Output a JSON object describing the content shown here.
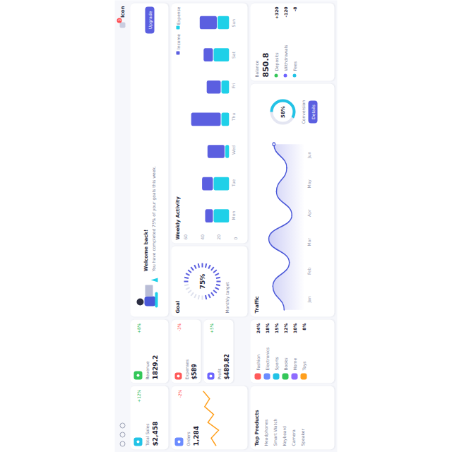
{
  "topbar": {
    "user": "Icon",
    "notifications": "3"
  },
  "stats": [
    {
      "label": "Total Sales",
      "value": "$2,458",
      "change": "+12%",
      "up": true,
      "color": "#22c3e6"
    },
    {
      "label": "Revenue",
      "value": "1829.2",
      "change": "+8%",
      "up": true,
      "color": "#34c759"
    }
  ],
  "banner": {
    "title": "Welcome back!",
    "text": "You have completed 75% of your goals this week.",
    "button": "Upgrade"
  },
  "orders": {
    "label": "Orders",
    "value": "1,284",
    "change": "-2%",
    "up": false,
    "series": [
      12,
      18,
      9,
      22,
      15,
      26,
      20,
      28
    ]
  },
  "mini_stats": [
    {
      "label": "Expenses",
      "value": "$589",
      "change": "-3%",
      "up": false,
      "color": "#ff5a5a"
    },
    {
      "label": "Profit",
      "value": "$489.82",
      "change": "+5%",
      "up": true,
      "color": "#6c63ff"
    }
  ],
  "gauge": {
    "label": "Goal",
    "reading": "75%",
    "level": 0.75,
    "caption": "Monthly target"
  },
  "bar_chart": {
    "title": "Weekly Activity",
    "legend": [
      {
        "label": "Income",
        "color": "#5b5fe0"
      },
      {
        "label": "Expense",
        "color": "#1fd0e8"
      }
    ],
    "labels": [
      "Mon",
      "Tue",
      "Wed",
      "Thu",
      "Fri",
      "Sat",
      "Sun"
    ],
    "ticks": [
      "60",
      "40",
      "20",
      "0"
    ],
    "series": [
      [
        10,
        14,
        22,
        38,
        18,
        12,
        22
      ],
      [
        20,
        20,
        5,
        10,
        10,
        20,
        15
      ]
    ]
  },
  "list": {
    "title": "Top Products",
    "items": [
      "Headphones",
      "Smart Watch",
      "Keyboard",
      "Camera",
      "Speaker"
    ]
  },
  "categories": [
    {
      "label": "Fashion",
      "value": "24%",
      "color": "#ff5a5a"
    },
    {
      "label": "Electronics",
      "value": "18%",
      "color": "#6c8cff"
    },
    {
      "label": "Sports",
      "value": "15%",
      "color": "#22c3e6"
    },
    {
      "label": "Books",
      "value": "12%",
      "color": "#34c759"
    },
    {
      "label": "Home",
      "value": "10%",
      "color": "#8e6cff"
    },
    {
      "label": "Toys",
      "value": "8%",
      "color": "#ff9f1c"
    }
  ],
  "line_chart": {
    "title": "Traffic",
    "labels": [
      "Jan",
      "Feb",
      "Mar",
      "Apr",
      "May",
      "Jun"
    ],
    "values": [
      40,
      62,
      30,
      70,
      25,
      55,
      35,
      60
    ]
  },
  "donut": {
    "label": "Conversion",
    "reading": "58%",
    "level": 0.58,
    "button": "Details"
  },
  "summary": {
    "label": "Balance",
    "value": "850.8",
    "items": [
      {
        "label": "Deposits",
        "value": "+320",
        "color": "#34c759"
      },
      {
        "label": "Withdrawals",
        "value": "-120",
        "color": "#6c63ff"
      },
      {
        "label": "Fees",
        "value": "-8",
        "color": "#22c3e6"
      }
    ]
  }
}
